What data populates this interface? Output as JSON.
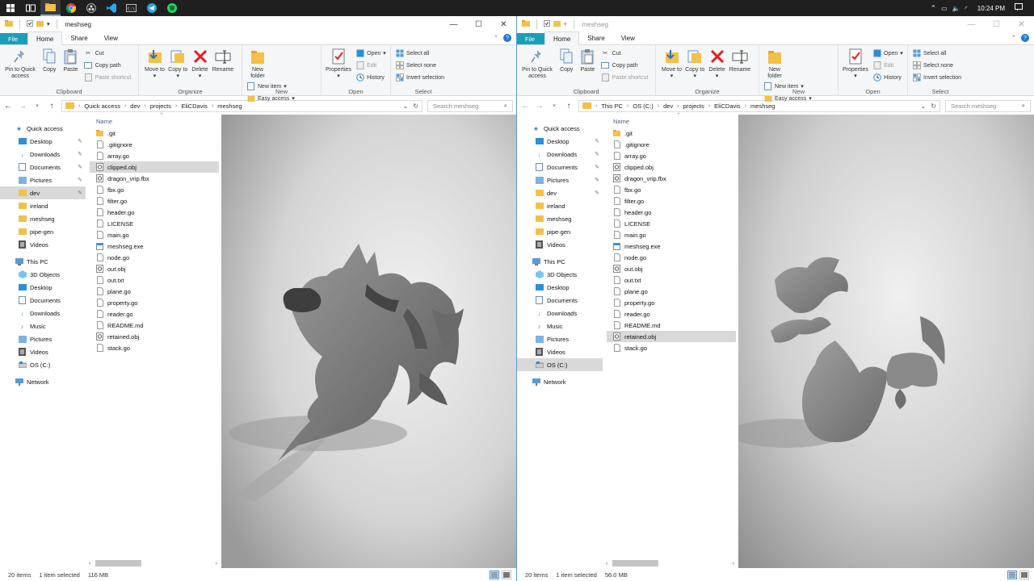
{
  "taskbar": {
    "apps": [
      "file-explorer",
      "chrome",
      "obs",
      "vscode",
      "terminal",
      "telegram",
      "spotify"
    ],
    "clock": "10:24 PM"
  },
  "left": {
    "title": "meshseg",
    "tabs": {
      "file": "File",
      "home": "Home",
      "share": "Share",
      "view": "View"
    },
    "ribbon": {
      "clipboard": {
        "label": "Clipboard",
        "pin": "Pin to Quick access",
        "copy": "Copy",
        "paste": "Paste",
        "cut": "Cut",
        "copy_path": "Copy path",
        "paste_shortcut": "Paste shortcut"
      },
      "organize": {
        "label": "Organize",
        "move_to": "Move to",
        "copy_to": "Copy to",
        "delete": "Delete",
        "rename": "Rename"
      },
      "new": {
        "label": "New",
        "new_folder": "New folder",
        "new_item": "New item",
        "easy_access": "Easy access"
      },
      "open": {
        "label": "Open",
        "properties": "Properties",
        "open": "Open",
        "edit": "Edit",
        "history": "History"
      },
      "select": {
        "label": "Select",
        "select_all": "Select all",
        "select_none": "Select none",
        "invert": "Invert selection"
      }
    },
    "breadcrumb": [
      "Quick access",
      "dev",
      "projects",
      "EliCDavis",
      "meshseg"
    ],
    "search_placeholder": "Search meshseg",
    "nav": {
      "quick_access": "Quick access",
      "quick_items": [
        "Desktop",
        "Downloads",
        "Documents",
        "Pictures",
        "dev",
        "ireland",
        "meshseg",
        "pipe-gen",
        "Videos"
      ],
      "this_pc": "This PC",
      "pc_items": [
        "3D Objects",
        "Desktop",
        "Documents",
        "Downloads",
        "Music",
        "Pictures",
        "Videos",
        "OS (C:)"
      ],
      "network": "Network"
    },
    "column_name": "Name",
    "files": [
      ".git",
      ".gitignore",
      "array.go",
      "clipped.obj",
      "dragon_vrip.fbx",
      "fbx.go",
      "filter.go",
      "header.go",
      "LICENSE",
      "main.go",
      "meshseg.exe",
      "node.go",
      "out.obj",
      "out.txt",
      "plane.go",
      "property.go",
      "reader.go",
      "README.md",
      "retained.obj",
      "stack.go"
    ],
    "selected_file": "clipped.obj",
    "status": {
      "items": "20 items",
      "selected": "1 item selected",
      "size": "116 MB"
    }
  },
  "right": {
    "title": "meshseg",
    "breadcrumb": [
      "This PC",
      "OS (C:)",
      "dev",
      "projects",
      "EliCDavis",
      "meshseg"
    ],
    "search_placeholder": "Search meshseg",
    "selected_file": "retained.obj",
    "status": {
      "items": "20 items",
      "selected": "1 item selected",
      "size": "56.0 MB"
    }
  }
}
